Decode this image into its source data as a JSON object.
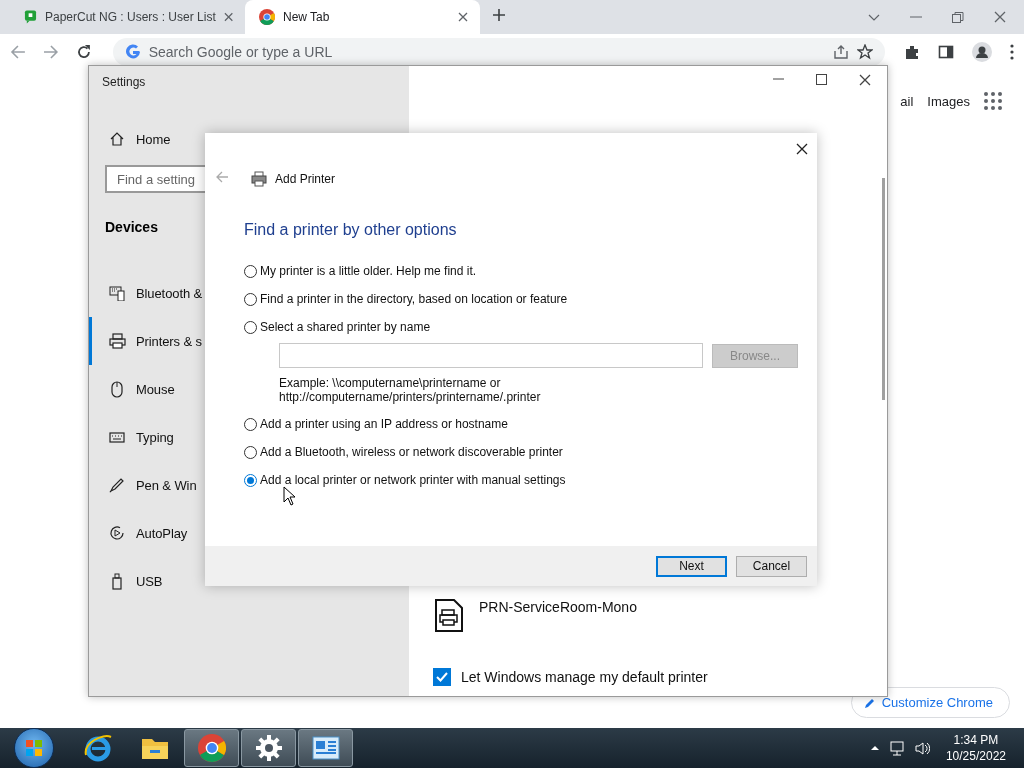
{
  "browser": {
    "tabs": [
      {
        "title": "PaperCut NG : Users : User List",
        "kind": "papercut",
        "selected": false
      },
      {
        "title": "New Tab",
        "kind": "chrome",
        "selected": true
      }
    ],
    "address_placeholder": "Search Google or type a URL"
  },
  "page": {
    "links": [
      "ail",
      "Images"
    ],
    "customize_button": "Customize Chrome"
  },
  "settings": {
    "title": "Settings",
    "home": "Home",
    "search_placeholder": "Find a setting",
    "section": "Devices",
    "items": [
      {
        "label": "Bluetooth &",
        "kind": "bluetooth",
        "selected": false
      },
      {
        "label": "Printers & s",
        "kind": "printer",
        "selected": true
      },
      {
        "label": "Mouse",
        "kind": "mouse",
        "selected": false
      },
      {
        "label": "Typing",
        "kind": "keyboard",
        "selected": false
      },
      {
        "label": "Pen & Win",
        "kind": "pen",
        "selected": false
      },
      {
        "label": "AutoPlay",
        "kind": "autoplay",
        "selected": false
      },
      {
        "label": "USB",
        "kind": "usb",
        "selected": false
      }
    ],
    "device": "PRN-ServiceRoom-Mono",
    "default_printer": {
      "label": "Let Windows manage my default printer",
      "checked": true
    }
  },
  "dialog": {
    "title": "Add Printer",
    "heading": "Find a printer by other options",
    "options": [
      {
        "label": "My printer is a little older. Help me find it.",
        "kind": "plain",
        "selected": false
      },
      {
        "label": "Find a printer in the directory, based on location or feature",
        "kind": "plain",
        "selected": false
      },
      {
        "label": "Select a shared printer by name",
        "kind": "shared_name",
        "selected": false
      },
      {
        "label": "Add a printer using an IP address or hostname",
        "kind": "plain",
        "selected": false
      },
      {
        "label": "Add a Bluetooth, wireless or network discoverable printer",
        "kind": "plain",
        "selected": false
      },
      {
        "label": "Add a local printer or network printer with manual settings",
        "kind": "plain",
        "selected": true
      }
    ],
    "browse": {
      "label": "Browse...",
      "disabled": true
    },
    "example": [
      "Example: \\\\computername\\printername or",
      "http://computername/printers/printername/.printer"
    ],
    "buttons": [
      {
        "label": "Next",
        "default": true
      },
      {
        "label": "Cancel",
        "default": false
      }
    ]
  },
  "taskbar": {
    "apps": [
      {
        "kind": "ie",
        "active": false
      },
      {
        "kind": "explorer",
        "active": false
      },
      {
        "kind": "chrome",
        "active": true
      },
      {
        "kind": "settings",
        "active": true
      },
      {
        "kind": "control_panel",
        "active": true
      }
    ],
    "time": "1:34 PM",
    "date": "10/25/2022"
  }
}
